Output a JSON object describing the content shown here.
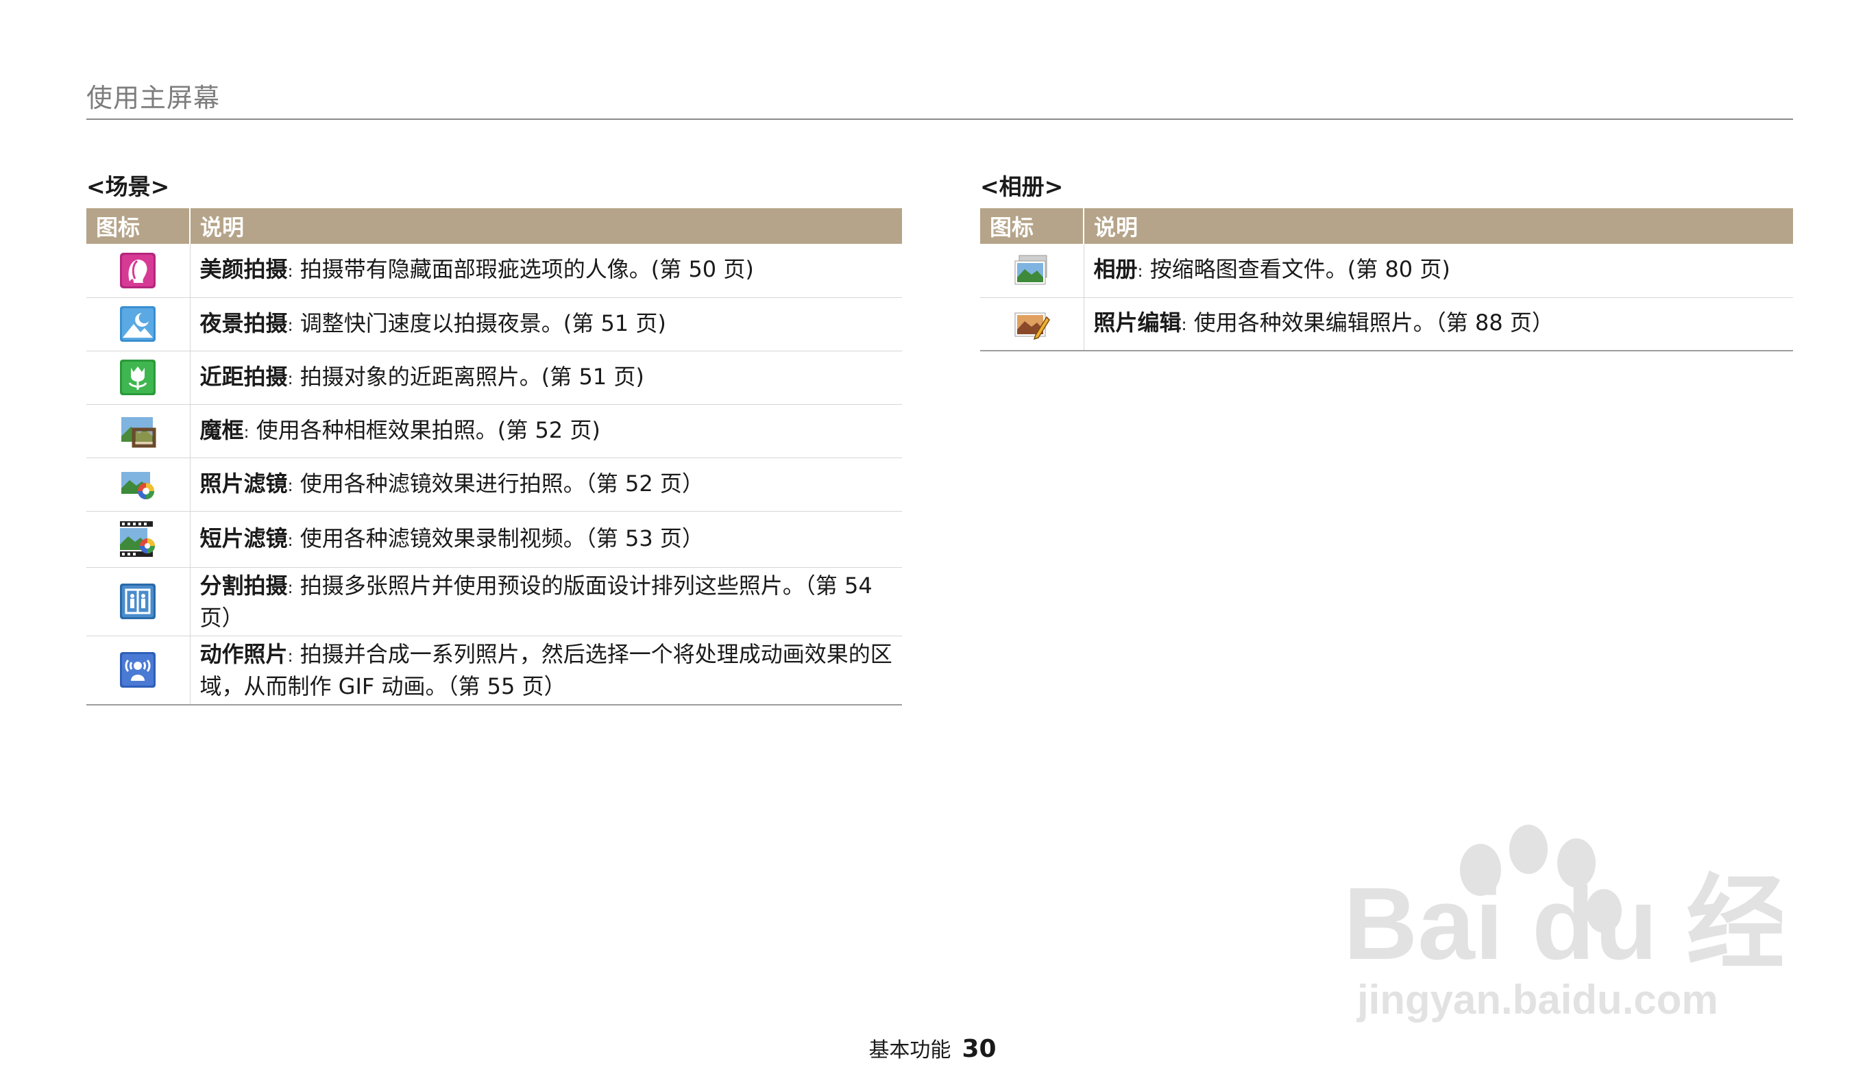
{
  "header": {
    "title": "使用主屏幕"
  },
  "scene": {
    "title": "<场景>",
    "col_icon": "图标",
    "col_desc": "说明",
    "rows": [
      {
        "icon": "beauty-face-icon",
        "term": "美颜拍摄",
        "sep": ":",
        "desc": "拍摄带有隐藏面部瑕疵选项的人像。(第 50 页)"
      },
      {
        "icon": "night-scene-icon",
        "term": "夜景拍摄",
        "sep": ":",
        "desc": "调整快门速度以拍摄夜景。(第 51 页)"
      },
      {
        "icon": "close-up-icon",
        "term": "近距拍摄",
        "sep": ":",
        "desc": "拍摄对象的近距离照片。(第 51 页)"
      },
      {
        "icon": "magic-frame-icon",
        "term": "魔框",
        "sep": ":",
        "desc": "使用各种相框效果拍照。(第 52 页)"
      },
      {
        "icon": "photo-filter-icon",
        "term": "照片滤镜",
        "sep": ":",
        "desc": "使用各种滤镜效果进行拍照。（第 52 页）"
      },
      {
        "icon": "movie-filter-icon",
        "term": "短片滤镜",
        "sep": ":",
        "desc": "使用各种滤镜效果录制视频。（第 53 页）"
      },
      {
        "icon": "split-shot-icon",
        "term": "分割拍摄",
        "sep": ":",
        "desc": "拍摄多张照片并使用预设的版面设计排列这些照片。（第 54 页）"
      },
      {
        "icon": "motion-photo-icon",
        "term": "动作照片",
        "sep": ":",
        "desc": "拍摄并合成一系列照片，然后选择一个将处理成动画效果的区域，从而制作 GIF 动画。（第 55 页）"
      }
    ]
  },
  "album": {
    "title": "<相册>",
    "col_icon": "图标",
    "col_desc": "说明",
    "rows": [
      {
        "icon": "album-icon",
        "term": "相册",
        "sep": ":",
        "desc": "按缩略图查看文件。(第 80 页)"
      },
      {
        "icon": "photo-editor-icon",
        "term": "照片编辑",
        "sep": ":",
        "desc": "使用各种效果编辑照片。（第 88 页）"
      }
    ]
  },
  "footer": {
    "label": "基本功能",
    "page": "30"
  },
  "watermark": {
    "brand": "Bai du 经验",
    "url": "jingyan.baidu.com"
  }
}
